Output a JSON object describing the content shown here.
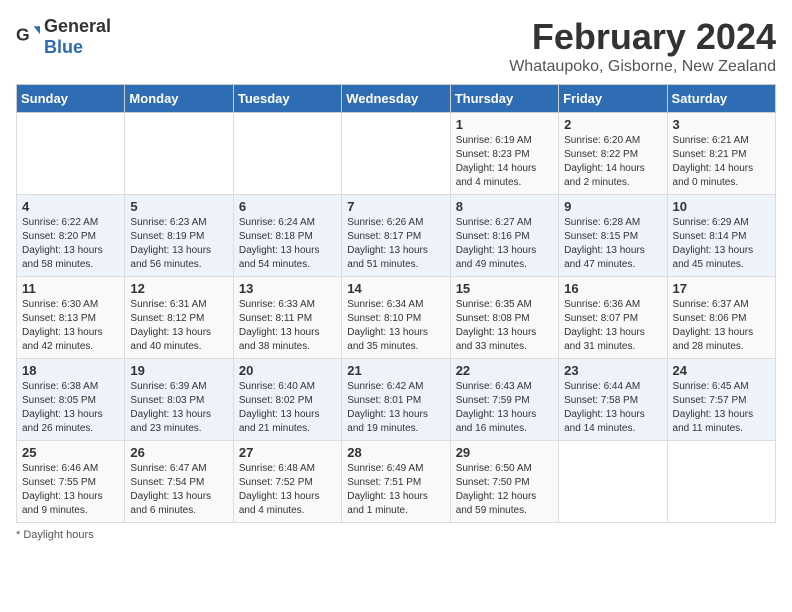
{
  "logo": {
    "general": "General",
    "blue": "Blue"
  },
  "header": {
    "month_year": "February 2024",
    "location": "Whataupoko, Gisborne, New Zealand"
  },
  "weekdays": [
    "Sunday",
    "Monday",
    "Tuesday",
    "Wednesday",
    "Thursday",
    "Friday",
    "Saturday"
  ],
  "weeks": [
    [
      null,
      null,
      null,
      null,
      {
        "day": "1",
        "sunrise": "6:19 AM",
        "sunset": "8:23 PM",
        "daylight": "14 hours and 4 minutes."
      },
      {
        "day": "2",
        "sunrise": "6:20 AM",
        "sunset": "8:22 PM",
        "daylight": "14 hours and 2 minutes."
      },
      {
        "day": "3",
        "sunrise": "6:21 AM",
        "sunset": "8:21 PM",
        "daylight": "14 hours and 0 minutes."
      }
    ],
    [
      {
        "day": "4",
        "sunrise": "6:22 AM",
        "sunset": "8:20 PM",
        "daylight": "13 hours and 58 minutes."
      },
      {
        "day": "5",
        "sunrise": "6:23 AM",
        "sunset": "8:19 PM",
        "daylight": "13 hours and 56 minutes."
      },
      {
        "day": "6",
        "sunrise": "6:24 AM",
        "sunset": "8:18 PM",
        "daylight": "13 hours and 54 minutes."
      },
      {
        "day": "7",
        "sunrise": "6:26 AM",
        "sunset": "8:17 PM",
        "daylight": "13 hours and 51 minutes."
      },
      {
        "day": "8",
        "sunrise": "6:27 AM",
        "sunset": "8:16 PM",
        "daylight": "13 hours and 49 minutes."
      },
      {
        "day": "9",
        "sunrise": "6:28 AM",
        "sunset": "8:15 PM",
        "daylight": "13 hours and 47 minutes."
      },
      {
        "day": "10",
        "sunrise": "6:29 AM",
        "sunset": "8:14 PM",
        "daylight": "13 hours and 45 minutes."
      }
    ],
    [
      {
        "day": "11",
        "sunrise": "6:30 AM",
        "sunset": "8:13 PM",
        "daylight": "13 hours and 42 minutes."
      },
      {
        "day": "12",
        "sunrise": "6:31 AM",
        "sunset": "8:12 PM",
        "daylight": "13 hours and 40 minutes."
      },
      {
        "day": "13",
        "sunrise": "6:33 AM",
        "sunset": "8:11 PM",
        "daylight": "13 hours and 38 minutes."
      },
      {
        "day": "14",
        "sunrise": "6:34 AM",
        "sunset": "8:10 PM",
        "daylight": "13 hours and 35 minutes."
      },
      {
        "day": "15",
        "sunrise": "6:35 AM",
        "sunset": "8:08 PM",
        "daylight": "13 hours and 33 minutes."
      },
      {
        "day": "16",
        "sunrise": "6:36 AM",
        "sunset": "8:07 PM",
        "daylight": "13 hours and 31 minutes."
      },
      {
        "day": "17",
        "sunrise": "6:37 AM",
        "sunset": "8:06 PM",
        "daylight": "13 hours and 28 minutes."
      }
    ],
    [
      {
        "day": "18",
        "sunrise": "6:38 AM",
        "sunset": "8:05 PM",
        "daylight": "13 hours and 26 minutes."
      },
      {
        "day": "19",
        "sunrise": "6:39 AM",
        "sunset": "8:03 PM",
        "daylight": "13 hours and 23 minutes."
      },
      {
        "day": "20",
        "sunrise": "6:40 AM",
        "sunset": "8:02 PM",
        "daylight": "13 hours and 21 minutes."
      },
      {
        "day": "21",
        "sunrise": "6:42 AM",
        "sunset": "8:01 PM",
        "daylight": "13 hours and 19 minutes."
      },
      {
        "day": "22",
        "sunrise": "6:43 AM",
        "sunset": "7:59 PM",
        "daylight": "13 hours and 16 minutes."
      },
      {
        "day": "23",
        "sunrise": "6:44 AM",
        "sunset": "7:58 PM",
        "daylight": "13 hours and 14 minutes."
      },
      {
        "day": "24",
        "sunrise": "6:45 AM",
        "sunset": "7:57 PM",
        "daylight": "13 hours and 11 minutes."
      }
    ],
    [
      {
        "day": "25",
        "sunrise": "6:46 AM",
        "sunset": "7:55 PM",
        "daylight": "13 hours and 9 minutes."
      },
      {
        "day": "26",
        "sunrise": "6:47 AM",
        "sunset": "7:54 PM",
        "daylight": "13 hours and 6 minutes."
      },
      {
        "day": "27",
        "sunrise": "6:48 AM",
        "sunset": "7:52 PM",
        "daylight": "13 hours and 4 minutes."
      },
      {
        "day": "28",
        "sunrise": "6:49 AM",
        "sunset": "7:51 PM",
        "daylight": "13 hours and 1 minute."
      },
      {
        "day": "29",
        "sunrise": "6:50 AM",
        "sunset": "7:50 PM",
        "daylight": "12 hours and 59 minutes."
      },
      null,
      null
    ]
  ],
  "footer": {
    "daylight_label": "Daylight hours"
  }
}
